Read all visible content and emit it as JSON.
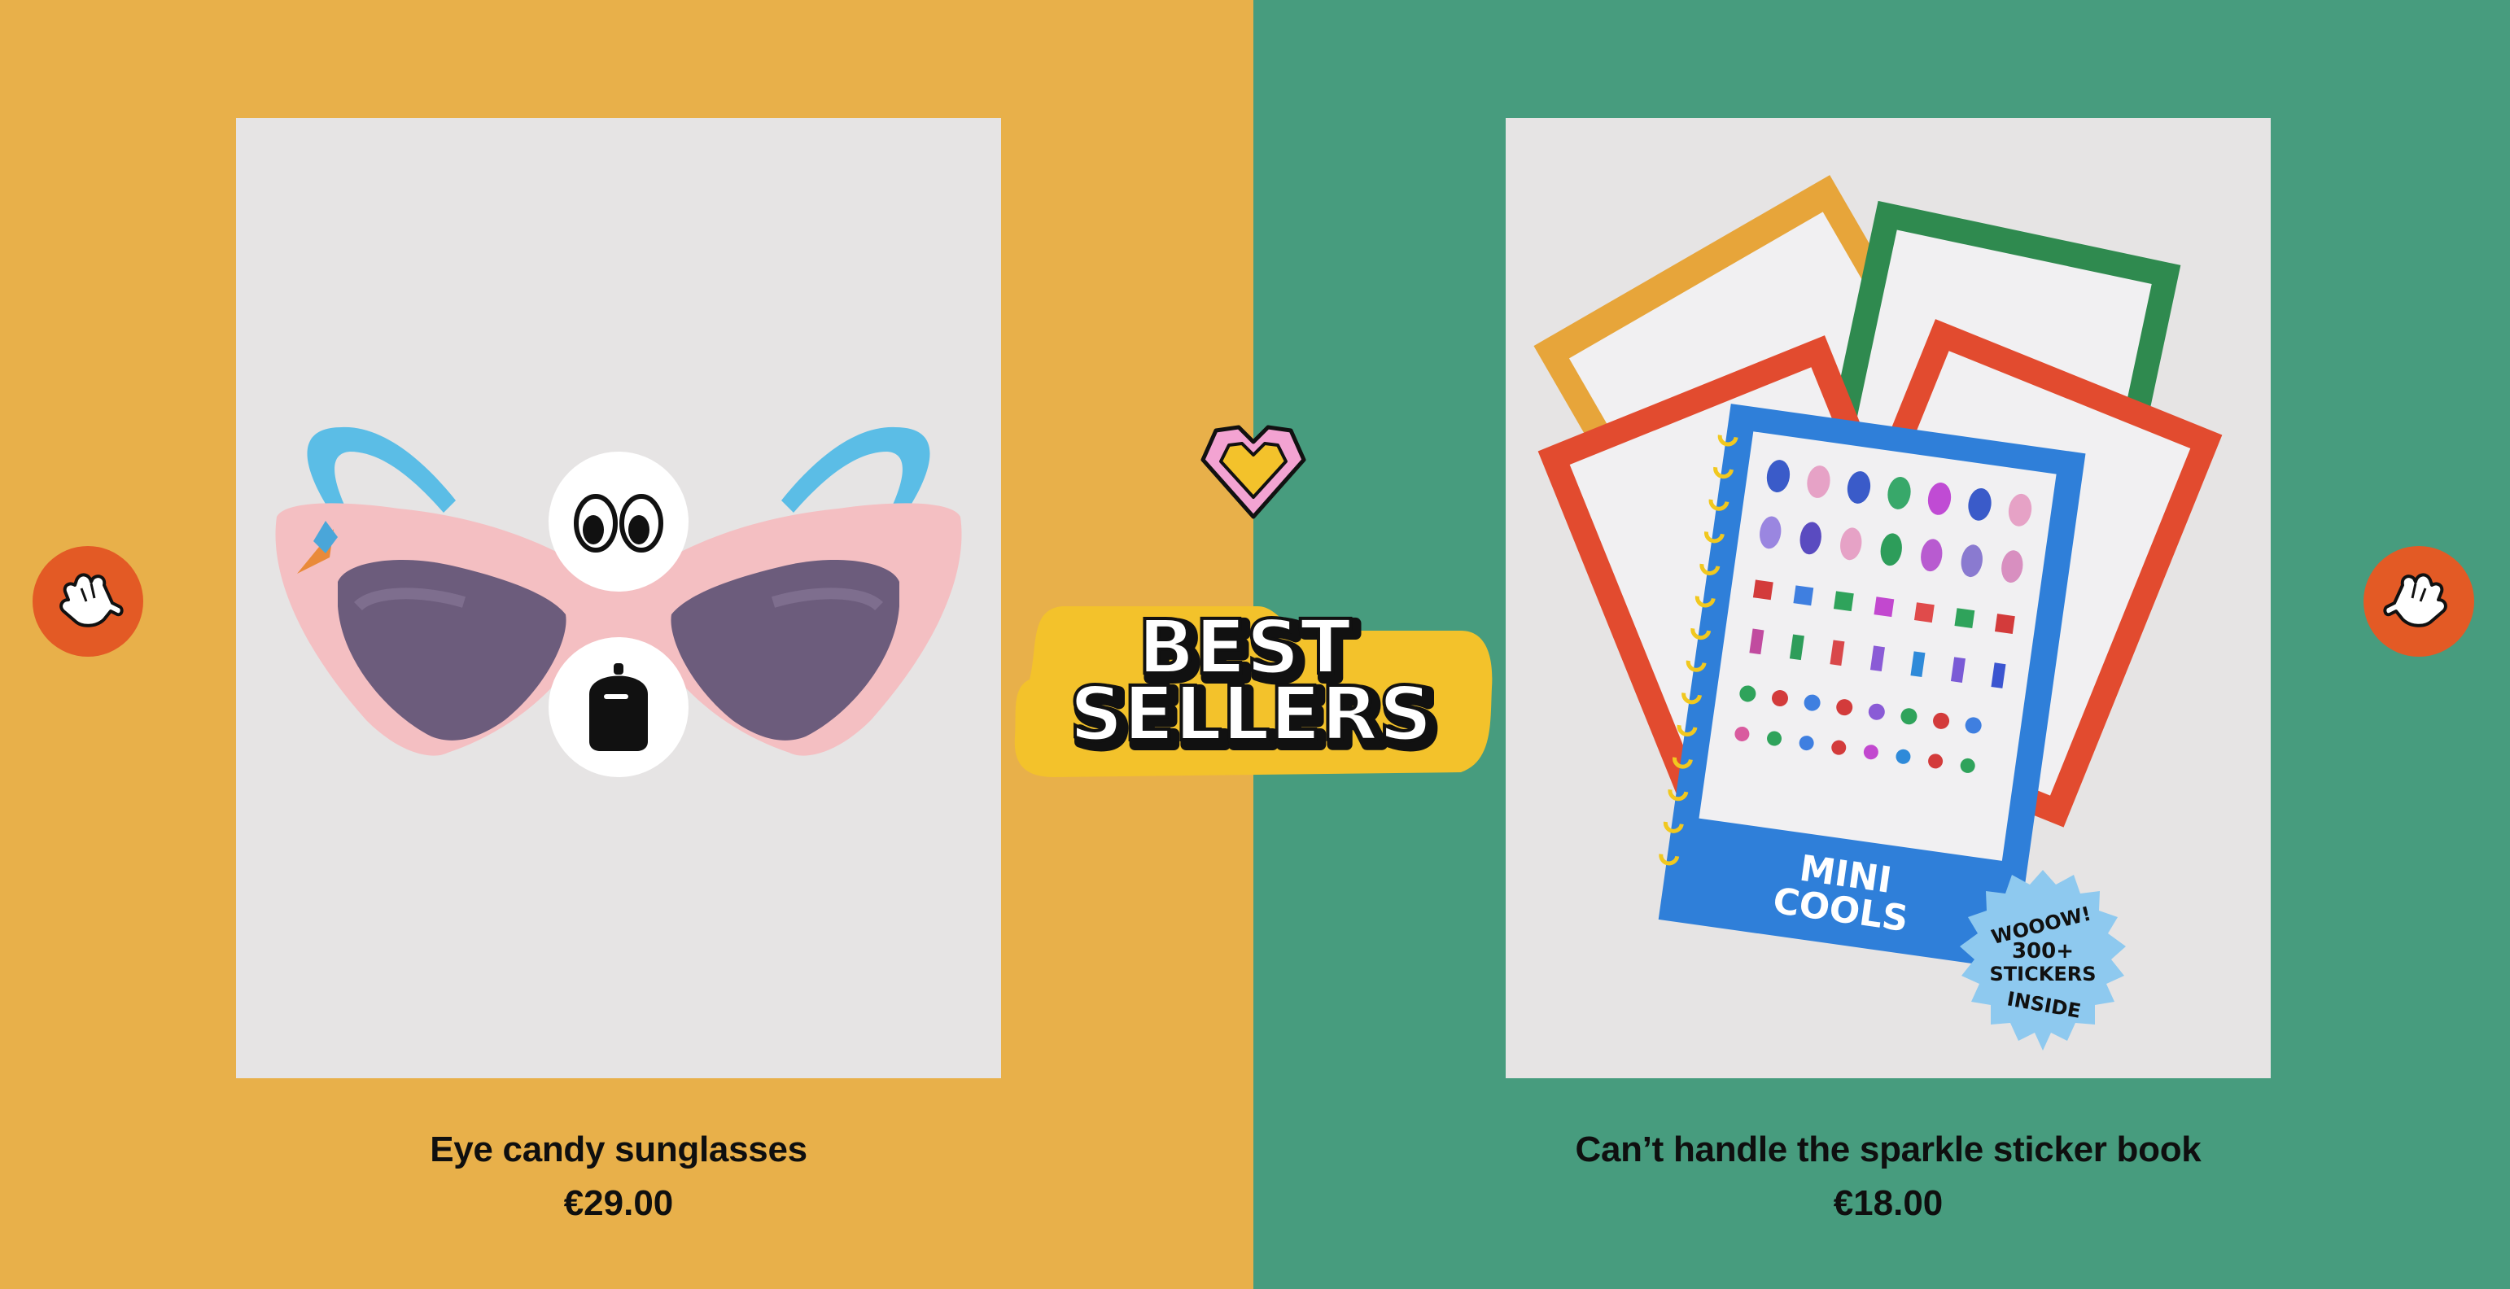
{
  "heading": {
    "line1": "BEST",
    "line2": "SELLERS"
  },
  "navigation": {
    "prev_icon": "glove-hand-icon",
    "next_icon": "glove-hand-icon"
  },
  "products": [
    {
      "title": "Eye candy sunglasses",
      "price": "€29.00",
      "panel_color": "#e8b04a",
      "overlay_icons": [
        "eyes-icon",
        "backpack-icon"
      ]
    },
    {
      "title": "Can’t handle the sparkle sticker book",
      "price": "€18.00",
      "panel_color": "#479c7e",
      "book_label_line1": "MINI",
      "book_label_line2": "COOLS",
      "stamp": {
        "line1": "WOOOW!",
        "line2": "300+",
        "line3": "STICKERS",
        "line4": "INSIDE"
      }
    }
  ],
  "colors": {
    "nav_button": "#e35a25",
    "image_bg": "#e6e4e4"
  }
}
